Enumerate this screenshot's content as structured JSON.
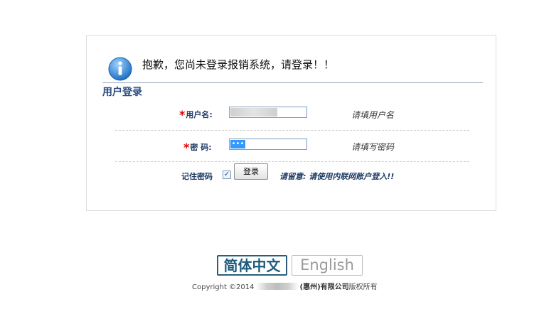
{
  "notice": {
    "message": "抱歉，您尚未登录报销系统，请登录！！"
  },
  "form": {
    "section_title": "用户登录",
    "username": {
      "required_mark": "*",
      "label": "用户名:",
      "value": "",
      "hint": "请填用户名"
    },
    "password": {
      "required_mark": "*",
      "label": "密 码:",
      "masked_value": "•••",
      "hint": "请填写密码"
    },
    "remember": {
      "label": "记住密码",
      "checked": true,
      "check_glyph": "✓"
    },
    "login_button": "登录",
    "attention": "请留意: 请使用内联网账户登入!!"
  },
  "footer": {
    "languages": [
      "简体中文",
      "English"
    ],
    "selected_language": "简体中文",
    "copyright_prefix": "Copyright ©2014",
    "company_suffix": "(惠州)有限公司",
    "rights": "版权所有"
  },
  "colors": {
    "accent": "#2a4d7f",
    "required": "#e00000",
    "selection": "#3399ff"
  }
}
